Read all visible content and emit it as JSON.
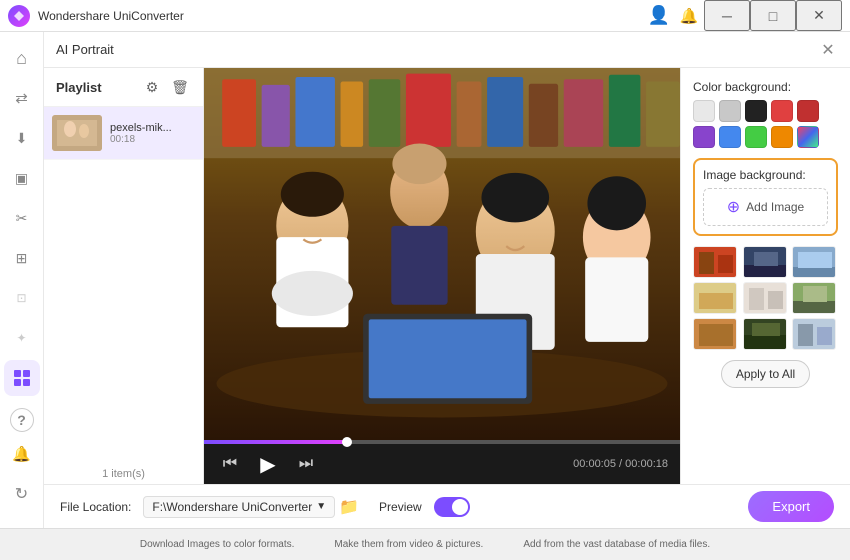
{
  "app": {
    "title": "Wondershare UniConverter",
    "logo_color": "#7c4dff"
  },
  "titlebar": {
    "title": "Wondershare UniConverter",
    "controls": {
      "minimize": "─",
      "maximize": "□",
      "close": "✕"
    },
    "user_icon": "👤",
    "bell_icon": "🔔"
  },
  "dialog": {
    "title": "AI Portrait",
    "close": "✕"
  },
  "playlist": {
    "title": "Playlist",
    "items": [
      {
        "name": "pexels-mik...",
        "duration": "00:18"
      }
    ],
    "count": "1 item(s)"
  },
  "video": {
    "current_time": "00:00:05",
    "total_time": "00:00:18",
    "progress_pct": 30
  },
  "right_panel": {
    "color_bg_label": "Color background:",
    "swatches": [
      {
        "id": "white",
        "color": "#e8e8e8"
      },
      {
        "id": "light-gray",
        "color": "#c8c8c8"
      },
      {
        "id": "black",
        "color": "#222222"
      },
      {
        "id": "red",
        "color": "#e04040"
      },
      {
        "id": "dark-red",
        "color": "#c03030"
      },
      {
        "id": "purple",
        "color": "#8844cc"
      },
      {
        "id": "blue",
        "color": "#4488ee"
      },
      {
        "id": "green",
        "color": "#44cc44"
      },
      {
        "id": "orange",
        "color": "#ee8800"
      },
      {
        "id": "multicolor",
        "color": "gradient"
      }
    ],
    "image_bg_label": "Image background:",
    "add_image_label": "Add Image",
    "apply_all_label": "Apply to All",
    "thumbnails": [
      {
        "id": "t1",
        "color1": "#cc4422",
        "color2": "#884411"
      },
      {
        "id": "t2",
        "color1": "#334466",
        "color2": "#556688"
      },
      {
        "id": "t3",
        "color1": "#6699cc",
        "color2": "#aaccee"
      },
      {
        "id": "t4",
        "color1": "#ddcc88",
        "color2": "#cc9944"
      },
      {
        "id": "t5",
        "color1": "#e8e0d8",
        "color2": "#d0c8c0"
      },
      {
        "id": "t6",
        "color1": "#88aa66",
        "color2": "#556644"
      },
      {
        "id": "t7",
        "color1": "#cc8844",
        "color2": "#996622"
      },
      {
        "id": "t8",
        "color1": "#334422",
        "color2": "#556633"
      },
      {
        "id": "t9",
        "color1": "#bbccdd",
        "color2": "#8899aa"
      }
    ]
  },
  "bottom_bar": {
    "file_location_label": "File Location:",
    "file_path": "F:\\Wondershare UniConverter",
    "preview_label": "Preview",
    "export_label": "Export"
  },
  "sidebar": {
    "icons": [
      {
        "id": "home",
        "symbol": "⌂"
      },
      {
        "id": "convert",
        "symbol": "⇄"
      },
      {
        "id": "download",
        "symbol": "⬇"
      },
      {
        "id": "screen",
        "symbol": "▣"
      },
      {
        "id": "scissors",
        "symbol": "✂"
      },
      {
        "id": "merge",
        "symbol": "⊞"
      },
      {
        "id": "compress",
        "symbol": "⊡"
      },
      {
        "id": "effects",
        "symbol": "✦"
      },
      {
        "id": "grid",
        "symbol": "⊞"
      }
    ],
    "bottom_icons": [
      {
        "id": "help",
        "symbol": "?"
      },
      {
        "id": "bell",
        "symbol": "🔔"
      },
      {
        "id": "refresh",
        "symbol": "↻"
      }
    ]
  },
  "status_bar": {
    "items": [
      "Download Images to color formats.",
      "Make them from video & pictures.",
      "Add from the vast database of media files."
    ]
  }
}
